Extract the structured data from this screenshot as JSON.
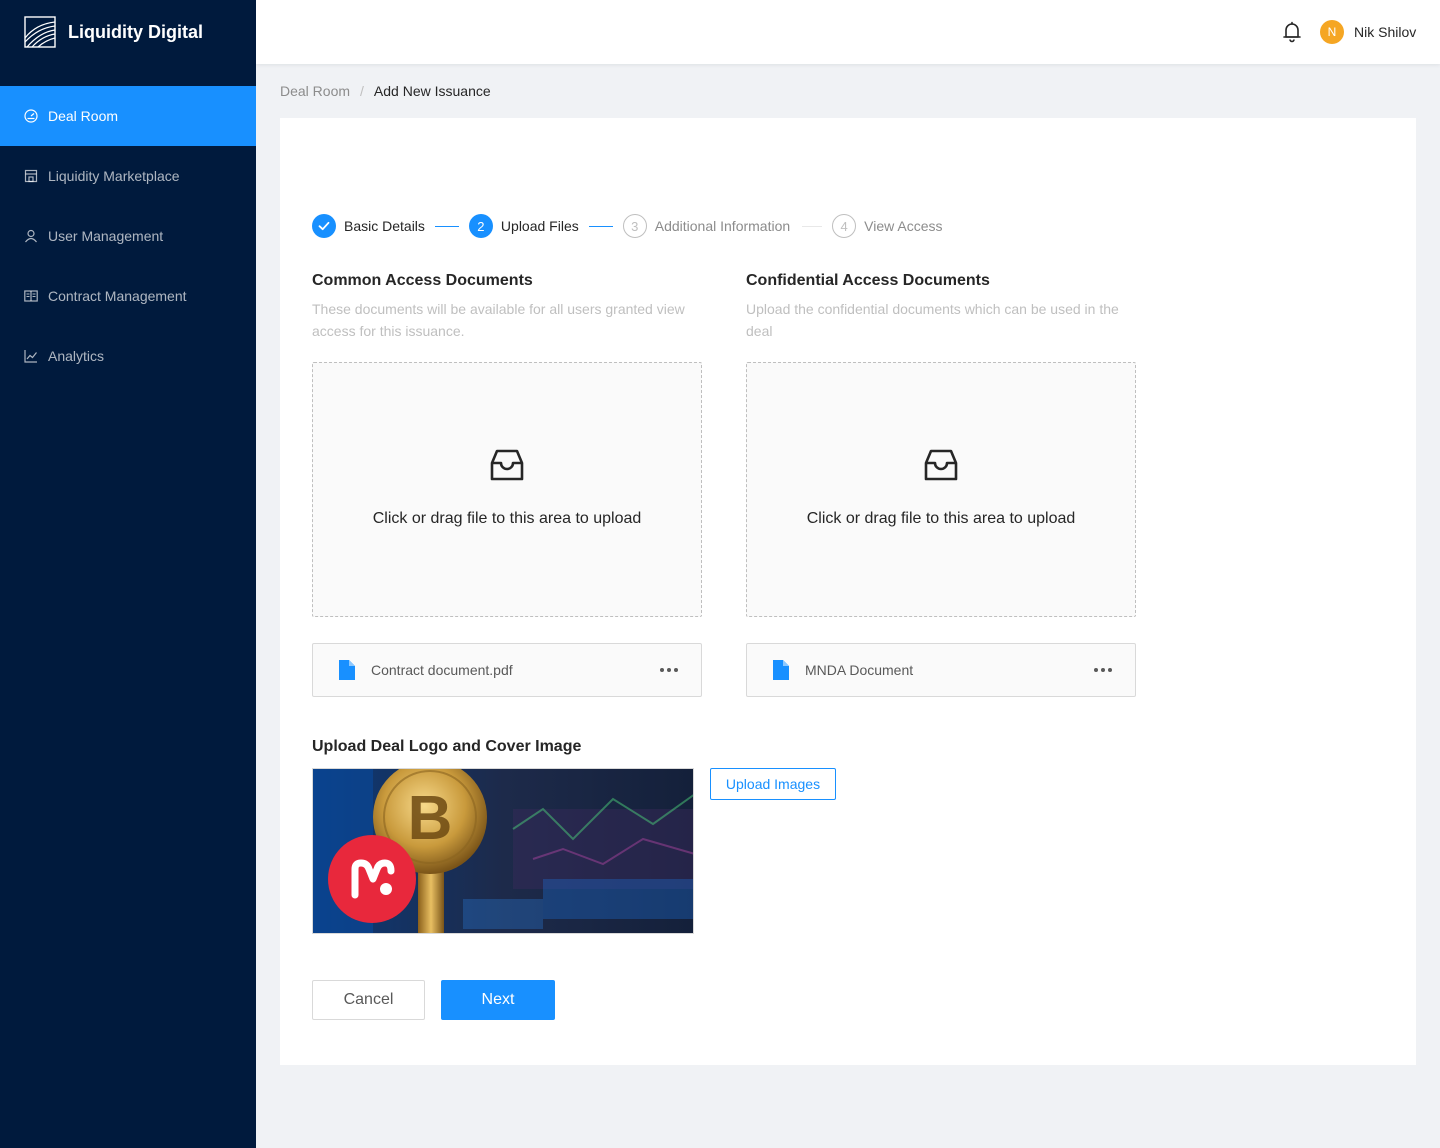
{
  "app": {
    "name": "Liquidity Digital"
  },
  "sidebar": {
    "items": [
      {
        "label": "Deal Room",
        "icon": "dashboard-icon",
        "active": true
      },
      {
        "label": "Liquidity Marketplace",
        "icon": "shop-icon"
      },
      {
        "label": "User Management",
        "icon": "user-icon"
      },
      {
        "label": "Contract Management",
        "icon": "book-icon"
      },
      {
        "label": "Analytics",
        "icon": "line-chart-icon"
      }
    ]
  },
  "header": {
    "user": {
      "initial": "N",
      "name": "Nik Shilov"
    },
    "icons": [
      "bell-icon"
    ]
  },
  "breadcrumb": {
    "parent": "Deal Room",
    "separator": "/",
    "current": "Add New Issuance"
  },
  "steps": [
    {
      "number": "1",
      "label": "Basic Details",
      "status": "done"
    },
    {
      "number": "2",
      "label": "Upload Files",
      "status": "current"
    },
    {
      "number": "3",
      "label": "Additional Information",
      "status": "wait"
    },
    {
      "number": "4",
      "label": "View Access",
      "status": "wait"
    }
  ],
  "common": {
    "title": "Common Access Documents",
    "description": "These documents will be available for all users granted view access for this issuance.",
    "dropzone_text": "Click or drag file to this area to upload",
    "file": {
      "name": "Contract document.pdf"
    }
  },
  "confidential": {
    "title": "Confidential Access Documents",
    "description": "Upload the confidential documents which can be used in the deal",
    "dropzone_text": "Click or drag file to this area to upload",
    "file": {
      "name": "MNDA Document"
    }
  },
  "images": {
    "title": "Upload Deal Logo and Cover Image",
    "upload_button": "Upload Images"
  },
  "actions": {
    "cancel": "Cancel",
    "next": "Next"
  },
  "colors": {
    "sidebar_bg": "#001a3d",
    "primary": "#1890ff",
    "avatar": "#f5a623",
    "logo_red": "#e8283c"
  }
}
